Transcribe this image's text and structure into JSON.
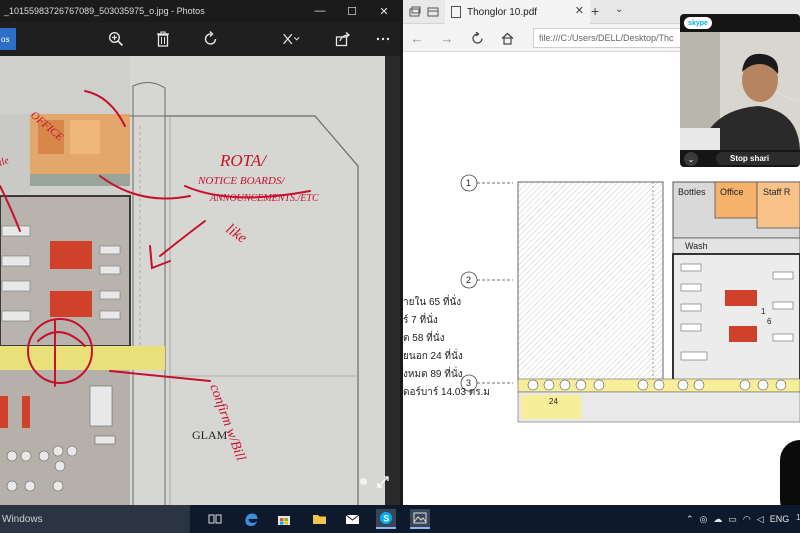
{
  "photos_window": {
    "title": "_10155983726767089_503035975_o.jpg - Photos",
    "window_controls": {
      "minimize": "—",
      "maximize": "☐",
      "close": "✕"
    },
    "home_label": "os",
    "toolbar_icons": [
      "zoom-in-icon",
      "delete-icon",
      "rotate-icon",
      "edit-icon",
      "share-icon",
      "more-icon"
    ],
    "photo": {
      "handwritten_notes": [
        "ROTA/",
        "NOTICE BOARDS/",
        "ANNOUNCEMENTS./ETC",
        "like",
        "confirm w/Bill",
        "OFFICE"
      ],
      "printed_label": "GLAM"
    }
  },
  "edge_window": {
    "tab_title": "Thonglor 10.pdf",
    "address": "file:///C:/Users/DELL/Desktop/Thc",
    "pdf": {
      "grid_markers": [
        "1",
        "2",
        "3"
      ],
      "room_labels": [
        "Bottles",
        "Office",
        "Staff R",
        "Wash",
        "24",
        "1",
        "6"
      ],
      "thai_lines": [
        "ายใน 65 ที่นั่ง",
        "ร์ 7 ที่นั่ง",
        "ต 58 ที่นั่ง",
        "ยนอก 24 ที่นั่ง",
        "ั้งหมด 89 ที่นั่ง",
        "ดอร์บาร์ 14.03 ตร.ม"
      ]
    }
  },
  "skype": {
    "logo_text": "skype",
    "stop_sharing_label": "Stop shari"
  },
  "taskbar": {
    "search_text": "Windows",
    "tray_lang": "ENG",
    "clock": "1"
  },
  "colors": {
    "taskbar": "#0e1a2b",
    "photos_chrome": "#1f1f1f",
    "accent_blue": "#2d6fc8",
    "annotation_red": "#c8102e",
    "plan_orange": "#f6b26b",
    "plan_yellow": "#f7ee9a"
  }
}
